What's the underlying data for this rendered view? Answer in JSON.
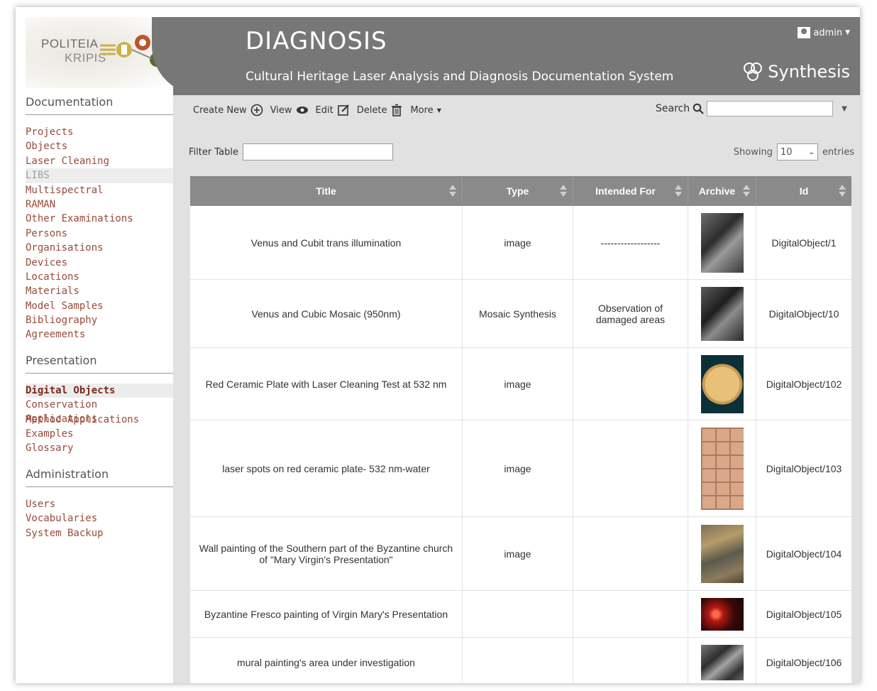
{
  "logo": {
    "line1": "POLITEIA",
    "line2": "KRIPIS"
  },
  "header": {
    "title": "DIAGNOSIS",
    "subtitle": "Cultural Heritage Laser Analysis and Diagnosis Documentation System",
    "user": "admin",
    "brand": "Synthesis"
  },
  "sidebar": {
    "sections": [
      {
        "title": "Documentation",
        "items": [
          "Projects",
          "Objects",
          "Laser Cleaning",
          "LIBS",
          "Multispectral",
          "RAMAN",
          "Other Examinations",
          "Persons",
          "Organisations",
          "Devices",
          "Locations",
          "Materials",
          "Model Samples",
          "Bibliography",
          "Agreements"
        ]
      },
      {
        "title": "Presentation",
        "items": [
          "Digital Objects",
          "Conservation Applications",
          "Method Applications",
          "Examples",
          "Glossary"
        ]
      },
      {
        "title": "Administration",
        "items": [
          "Users",
          "Vocabularies",
          "System Backup"
        ]
      }
    ]
  },
  "toolbar": {
    "create": "Create New",
    "view": "View",
    "edit": "Edit",
    "delete": "Delete",
    "more": "More",
    "search": "Search"
  },
  "filter": {
    "label": "Filter Table",
    "value": ""
  },
  "paging": {
    "showing": "Showing",
    "entries_value": "10",
    "entries": "entries"
  },
  "table": {
    "columns": [
      "Title",
      "Type",
      "Intended For",
      "Archive",
      "Id"
    ],
    "rows": [
      {
        "title": "Venus and Cubit trans illumination",
        "type": "image",
        "intended": "------------------",
        "id": "DigitalObject/1"
      },
      {
        "title": "Venus and Cubic Mosaic (950nm)",
        "type": "Mosaic Synthesis",
        "intended": "Observation of damaged areas",
        "id": "DigitalObject/10"
      },
      {
        "title": "Red Ceramic Plate with Laser Cleaning Test at 532 nm",
        "type": "image",
        "intended": "",
        "id": "DigitalObject/102"
      },
      {
        "title": "laser spots on red ceramic plate- 532 nm-water",
        "type": "image",
        "intended": "",
        "id": "DigitalObject/103"
      },
      {
        "title": "Wall painting of the Southern part of the Byzantine church of \"Mary Virgin's Presentation\"",
        "type": "image",
        "intended": "",
        "id": "DigitalObject/104"
      },
      {
        "title": "Byzantine Fresco painting of Virgin Mary's Presentation",
        "type": "",
        "intended": "",
        "id": "DigitalObject/105"
      },
      {
        "title": "mural painting's area under investigation",
        "type": "",
        "intended": "",
        "id": "DigitalObject/106"
      }
    ]
  }
}
